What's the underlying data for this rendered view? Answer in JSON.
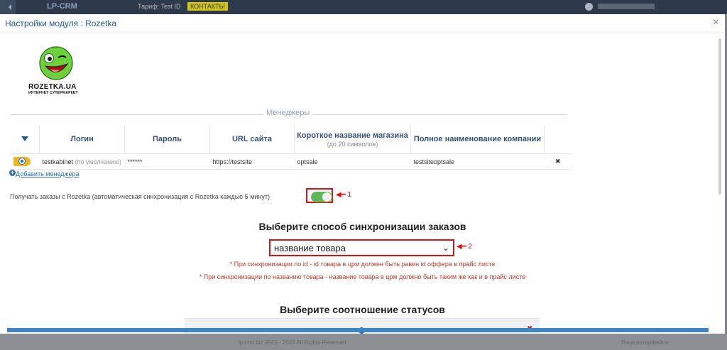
{
  "background": {
    "brand": "LP-CRM",
    "tariff": "Тариф: Test ID",
    "badge": "КОНТАКТЫ",
    "footer_copy": "lp-crm.biz 2015 - 2023 All Rights Reserved",
    "footer_lang": "Язык интерфейса:"
  },
  "modal": {
    "title": "Настройки модуля : Rozetka",
    "close_symbol": "×"
  },
  "logo": {
    "text": "ROZETKA.UA",
    "subtitle": "ИНТЕРНЕТ СУПЕРМАРКЕТ"
  },
  "managers": {
    "legend": "Менеджеры",
    "columns": {
      "login": "Логин",
      "password": "Пароль",
      "url": "URL сайта",
      "shop_short": "Короткое название магазина",
      "shop_short_hint": "(до 20 символов)",
      "company_full": "Полное наименование компании"
    },
    "rows": [
      {
        "login": "testkabinet",
        "default_note": "(по умолчанию)",
        "password": "******",
        "url": "https://testsite",
        "shop_short": "optsale",
        "company_full": "testsiteoptsale",
        "delete_symbol": "✖"
      }
    ],
    "add_label": "Добавить менеджера",
    "sort_symbol": "▼"
  },
  "sync": {
    "label": "Получать заказы с Rozetka (автоматическая синхронизация с Rozetka каждые 5 минут)",
    "enabled": true,
    "annotation1": "◀━ 1"
  },
  "method": {
    "heading": "Выберите способ синхронизации заказов",
    "selected": "название товара",
    "annotation2": "◀━ 2",
    "note1": "* При синхронизации по id - id товара в црм должен быть равен id оффера в прайс листе",
    "note2": "* При синхронизации по названию товара - название товара в црм должно быть таким же как и в прайс листе"
  },
  "status": {
    "heading": "Выберите соотношение статусов"
  },
  "colors": {
    "accent": "#1f5c99",
    "toggle_on": "#5db85c",
    "annotation": "#dd1111",
    "default_badge": "#f4b620"
  }
}
